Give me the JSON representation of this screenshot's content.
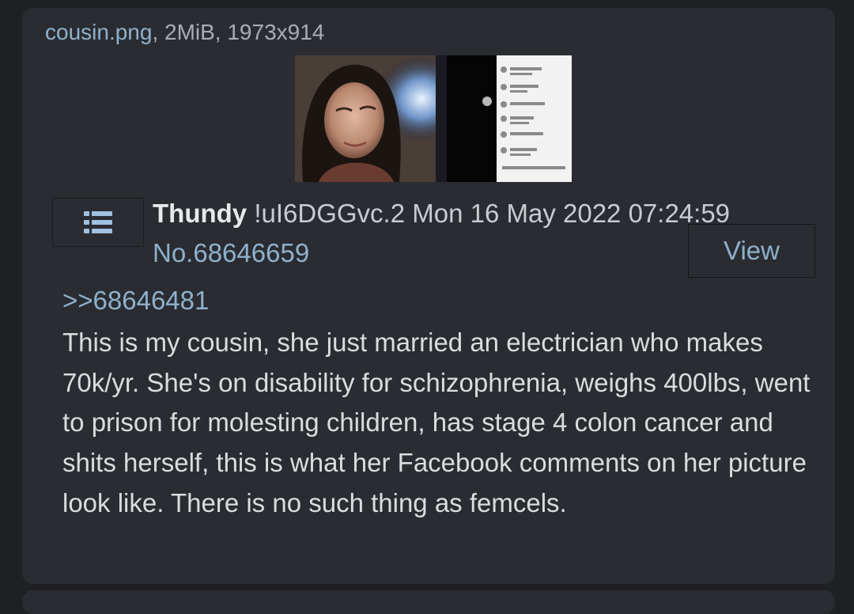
{
  "file": {
    "name": "cousin.png",
    "meta": ", 2MiB, 1973x914"
  },
  "thumbnail": {
    "alt": "cousin.png"
  },
  "post": {
    "name": "Thundy",
    "tripcode": "!uI6DGGvc.2",
    "datetime": "Mon 16 May 2022 07:24:59",
    "number": "No.68646659",
    "quote_link": ">>68646481",
    "body": "This is my cousin, she just married an electrician who makes 70k/yr. She's on disability for schizophrenia, weighs 400lbs, went to prison for molesting children, has stage 4 colon cancer and shits herself, this is what her Facebook comments on her picture look like. There is no such thing as femcels."
  },
  "actions": {
    "view_label": "View",
    "menu_icon": "list-menu-icon"
  },
  "colors": {
    "background": "#1f2023",
    "card": "#2a2c31",
    "link": "#8fb1cc",
    "text": "#dadcdf"
  }
}
